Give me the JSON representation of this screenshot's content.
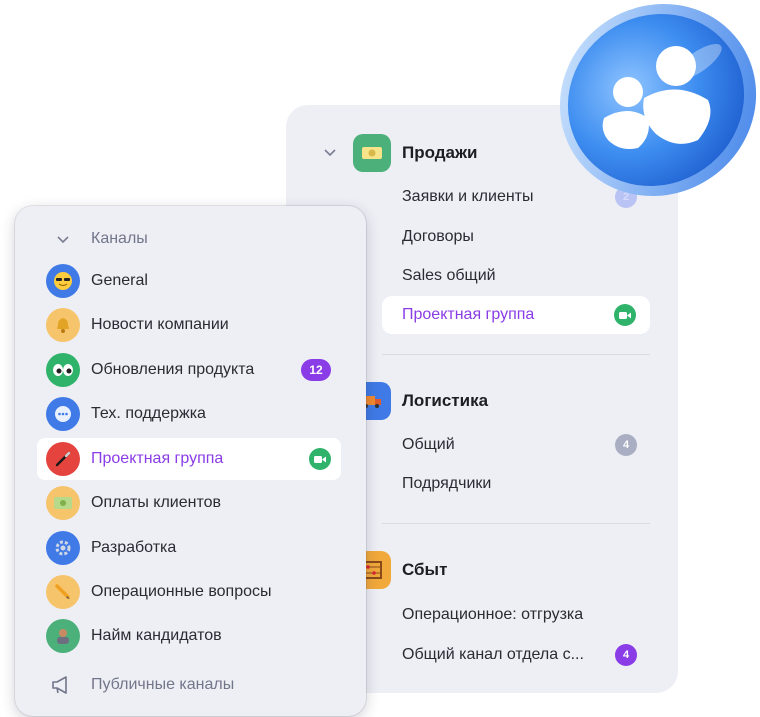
{
  "back_panel": {
    "groups": [
      {
        "title": "Продажи",
        "icon": "money-icon",
        "icon_color": "#4cb07a",
        "items": [
          {
            "label": "Заявки и клиенты",
            "badge": "2"
          },
          {
            "label": "Договоры"
          },
          {
            "label": "Sales общий"
          },
          {
            "label": "Проектная группа",
            "active": true,
            "status": "video-call-icon"
          }
        ]
      },
      {
        "title": "Логистика",
        "icon": "truck-icon",
        "icon_color": "#3f7ae6",
        "items": [
          {
            "label": "Общий",
            "badge": "4"
          },
          {
            "label": "Подрядчики"
          }
        ]
      },
      {
        "title": "Сбыт",
        "icon": "abacus-icon",
        "icon_color": "#f2a93b",
        "items": [
          {
            "label": "Операционное: отгрузка"
          },
          {
            "label": "Общий канал отдела с...",
            "badge": "4"
          }
        ]
      }
    ]
  },
  "front_panel": {
    "section_label": "Каналы",
    "channels": [
      {
        "label": "General",
        "icon": "sunglasses-icon",
        "color": "#3f7ae6"
      },
      {
        "label": "Новости компании",
        "icon": "bell-icon",
        "color": "#f5c46b"
      },
      {
        "label": "Обновления продукта",
        "icon": "eyes-icon",
        "color": "#2fb36a",
        "badge": "12"
      },
      {
        "label": "Тех. поддержка",
        "icon": "chat-bubble-icon",
        "color": "#3f7ae6"
      },
      {
        "label": "Проектная группа",
        "icon": "pen-icon",
        "color": "#e5433d",
        "active": true,
        "status": "video-call-icon"
      },
      {
        "label": "Оплаты клиентов",
        "icon": "money-icon",
        "color": "#f5c46b"
      },
      {
        "label": "Разработка",
        "icon": "gear-icon",
        "color": "#3f7ae6"
      },
      {
        "label": "Операционные вопросы",
        "icon": "pencil-icon",
        "color": "#f5c46b"
      },
      {
        "label": "Найм кандидатов",
        "icon": "person-icon",
        "color": "#4cb07a"
      }
    ],
    "public_label": "Публичные каналы"
  },
  "colors": {
    "accent": "#8a3ce6",
    "video": "#2fb36a",
    "panel_bg": "#eeeff5"
  }
}
